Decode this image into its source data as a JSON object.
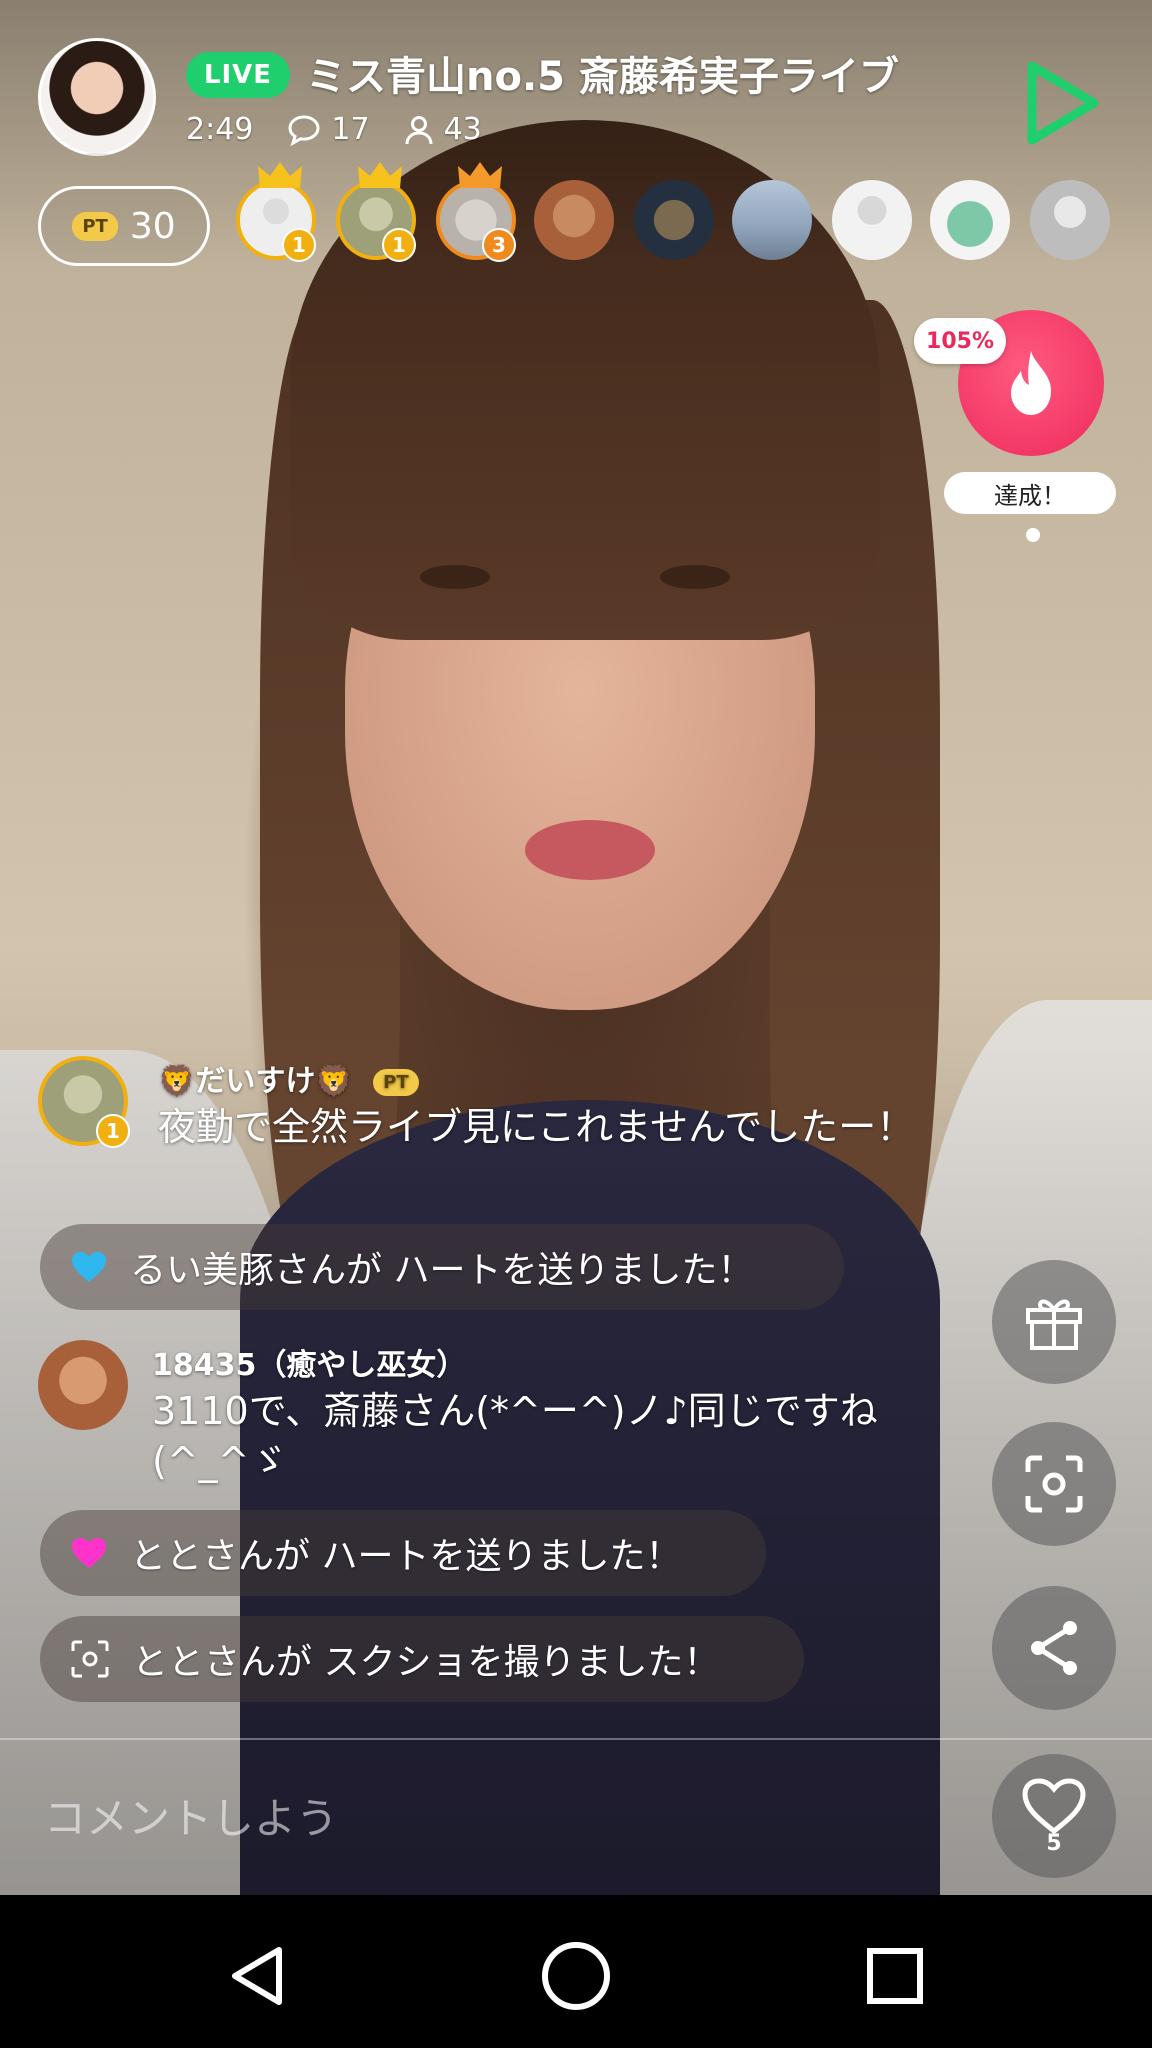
{
  "header": {
    "live_label": "LIVE",
    "title": "ミス青山no.5 斎藤希実子ライブ",
    "elapsed": "2:49",
    "comment_count": "17",
    "viewer_count": "43"
  },
  "points": {
    "badge": "PT",
    "value": "30"
  },
  "top_viewers": [
    {
      "rank": "1",
      "crown": true
    },
    {
      "rank": "1",
      "crown": true
    },
    {
      "rank": "3",
      "crown": true
    },
    {
      "rank": "",
      "crown": false
    },
    {
      "rank": "",
      "crown": false
    },
    {
      "rank": "",
      "crown": false
    },
    {
      "rank": "",
      "crown": false
    },
    {
      "rank": "",
      "crown": false
    },
    {
      "rank": "",
      "crown": false
    }
  ],
  "goal": {
    "percent_label": "105%",
    "status_label": "達成！"
  },
  "chat": [
    {
      "type": "comment",
      "user": "🦁だいすけ🦁",
      "badge": "PT",
      "avatar_rank": "1",
      "text": "夜勤で全然ライブ見にこれませんでしたー！"
    },
    {
      "type": "system",
      "icon": "heart-blue",
      "text": "るい美豚さんが ハートを送りました！"
    },
    {
      "type": "comment",
      "user": "18435（癒やし巫女）",
      "text": "3110で、斎藤さん(*^ー^)ノ♪同じですね(^_^ゞ"
    },
    {
      "type": "system",
      "icon": "heart-pink",
      "text": "ととさんが ハートを送りました！"
    },
    {
      "type": "system",
      "icon": "screenshot",
      "text": "ととさんが スクショを撮りました！"
    }
  ],
  "actions": {
    "like_count": "5"
  },
  "comment_box": {
    "placeholder": "コメントしよう"
  },
  "colors": {
    "live_green": "#1fce6c",
    "goal_red": "#ee2a5c",
    "rank_gold": "#f2b010",
    "rank_orange": "#f08a1c",
    "heart_blue": "#2fb8f0",
    "heart_pink": "#ff33cc"
  }
}
